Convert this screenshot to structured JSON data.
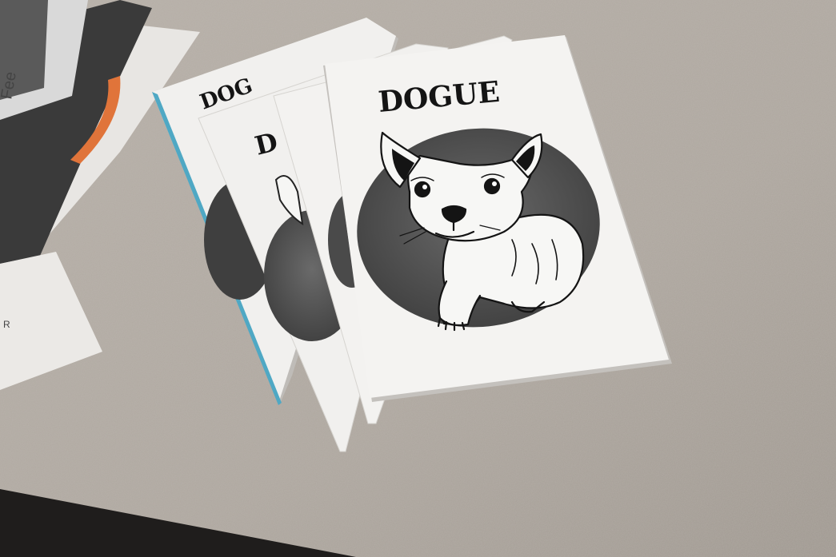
{
  "zine": {
    "title": "DOGUE",
    "partial_title_1": "DOG",
    "partial_title_2": "D"
  },
  "left_items": {
    "partial_text_1": "Fee",
    "partial_text_2": "R"
  },
  "colors": {
    "table": "#b3aca4",
    "paper": "#f1f0ee",
    "circle": "#5c5c5c",
    "ink": "#141414",
    "blue_edge": "#4fa8c4",
    "orange_accent": "#e0743a"
  }
}
